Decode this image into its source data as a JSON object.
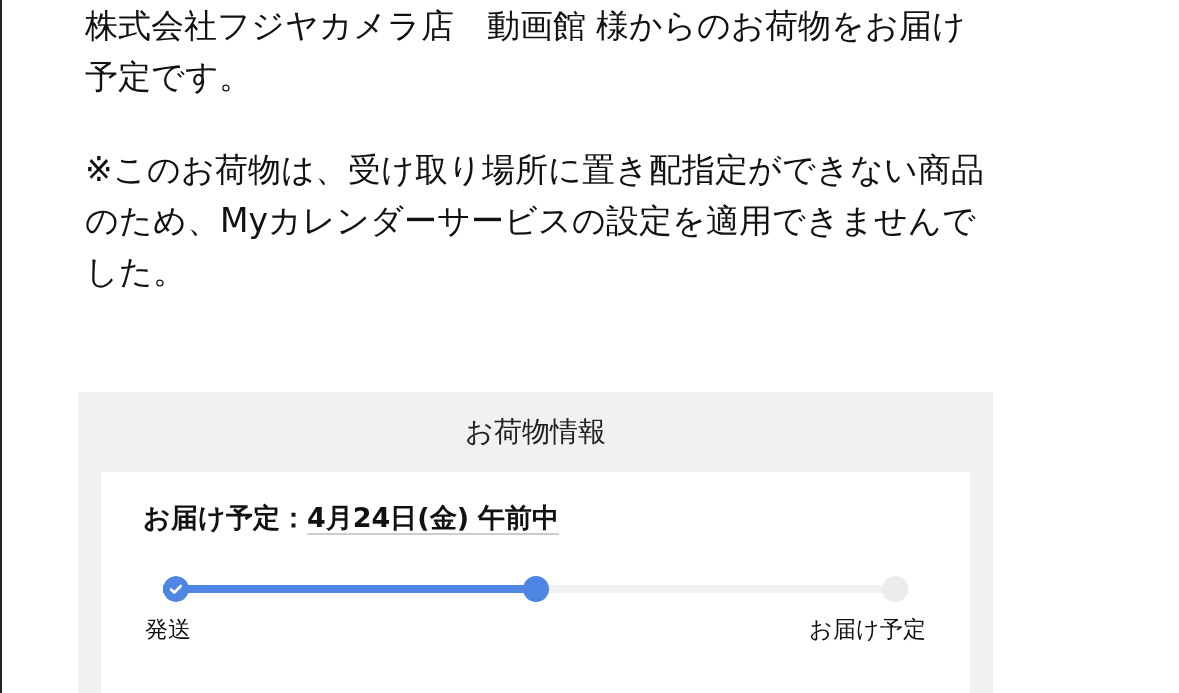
{
  "message": {
    "paragraphs": [
      "株式会社フジヤカメラ店　動画館 様からのお荷物をお届け予定です。",
      "※このお荷物は、受け取り場所に置き配指定ができない商品のため、Myカレンダーサービスの設定を適用できませんでした。"
    ]
  },
  "package_info": {
    "title": "お荷物情報",
    "delivery_label": "お届け予定：",
    "delivery_date": "4月24日(金) 午前中",
    "progress": {
      "level": 0.5,
      "steps": [
        {
          "kind": "done",
          "label": "発送"
        },
        {
          "kind": "current"
        },
        {
          "kind": "pending",
          "label": "お届け予定"
        }
      ]
    }
  }
}
